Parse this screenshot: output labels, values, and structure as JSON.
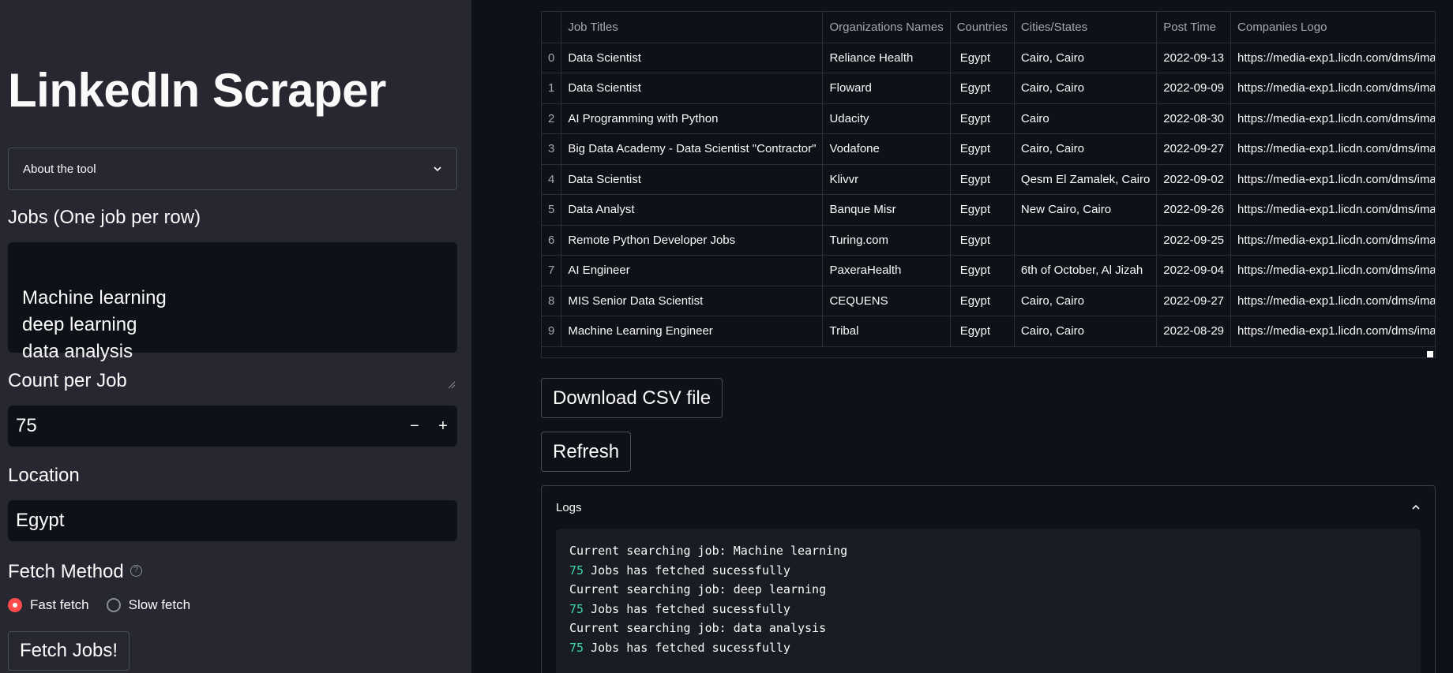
{
  "sidebar": {
    "title": "LinkedIn Scraper",
    "expander_label": "About the tool",
    "jobs_label": "Jobs (One job per row)",
    "jobs_value": "Machine learning\ndeep learning\ndata analysis",
    "count_label": "Count per Job",
    "count_value": "75",
    "minus": "−",
    "plus": "+",
    "location_label": "Location",
    "location_value": "Egypt",
    "fetch_method_label": "Fetch Method",
    "help_glyph": "?",
    "radio_options": [
      {
        "label": "Fast fetch",
        "selected": true
      },
      {
        "label": "Slow fetch",
        "selected": false
      }
    ],
    "fetch_button": "Fetch Jobs!"
  },
  "table": {
    "columns": [
      "",
      "Job Titles",
      "Organizations Names",
      "Countries",
      "Cities/States",
      "Post Time",
      "Companies Logo"
    ],
    "rows": [
      [
        "0",
        "Data Scientist",
        "Reliance Health",
        "Egypt",
        "Cairo,  Cairo",
        "2022-09-13",
        "https://media-exp1.licdn.com/dms/image"
      ],
      [
        "1",
        "Data Scientist",
        "Floward",
        "Egypt",
        "Cairo,  Cairo",
        "2022-09-09",
        "https://media-exp1.licdn.com/dms/image"
      ],
      [
        "2",
        "AI Programming with Python",
        "Udacity",
        "Egypt",
        "Cairo",
        "2022-08-30",
        "https://media-exp1.licdn.com/dms/image"
      ],
      [
        "3",
        "Big Data Academy - Data Scientist \"Contractor\"",
        "Vodafone",
        "Egypt",
        "Cairo,  Cairo",
        "2022-09-27",
        "https://media-exp1.licdn.com/dms/image"
      ],
      [
        "4",
        "Data Scientist",
        "Klivvr",
        "Egypt",
        "Qesm El Zamalek,  Cairo",
        "2022-09-02",
        "https://media-exp1.licdn.com/dms/image"
      ],
      [
        "5",
        "Data Analyst",
        "Banque Misr",
        "Egypt",
        "New Cairo,  Cairo",
        "2022-09-26",
        "https://media-exp1.licdn.com/dms/image"
      ],
      [
        "6",
        "Remote Python Developer Jobs",
        "Turing.com",
        "Egypt",
        "",
        "2022-09-25",
        "https://media-exp1.licdn.com/dms/image"
      ],
      [
        "7",
        "AI Engineer",
        "PaxeraHealth",
        "Egypt",
        "6th of October,  Al Jizah",
        "2022-09-04",
        "https://media-exp1.licdn.com/dms/image"
      ],
      [
        "8",
        "MIS Senior Data Scientist",
        "CEQUENS",
        "Egypt",
        "Cairo,  Cairo",
        "2022-09-27",
        "https://media-exp1.licdn.com/dms/image"
      ],
      [
        "9",
        "Machine Learning Engineer",
        "Tribal",
        "Egypt",
        "Cairo,  Cairo",
        "2022-08-29",
        "https://media-exp1.licdn.com/dms/image"
      ]
    ]
  },
  "main": {
    "download_button": "Download CSV file",
    "refresh_button": "Refresh",
    "logs_label": "Logs",
    "log_lines": [
      {
        "num": "",
        "text": "Current searching job: Machine learning"
      },
      {
        "num": "75",
        "text": " Jobs has fetched sucessfully"
      },
      {
        "num": "",
        "text": "Current searching job: deep learning"
      },
      {
        "num": "75",
        "text": " Jobs has fetched sucessfully"
      },
      {
        "num": "",
        "text": "Current searching job: data analysis"
      },
      {
        "num": "75",
        "text": " Jobs has fetched sucessfully"
      }
    ]
  },
  "colors": {
    "sidebar_bg": "#262730",
    "main_bg": "#0e1117",
    "accent": "#ff4b4b",
    "log_number": "#3dd6b2"
  },
  "icons": [
    "chevron-down-icon",
    "chevron-up-icon",
    "help-icon",
    "resize-grip-icon"
  ]
}
